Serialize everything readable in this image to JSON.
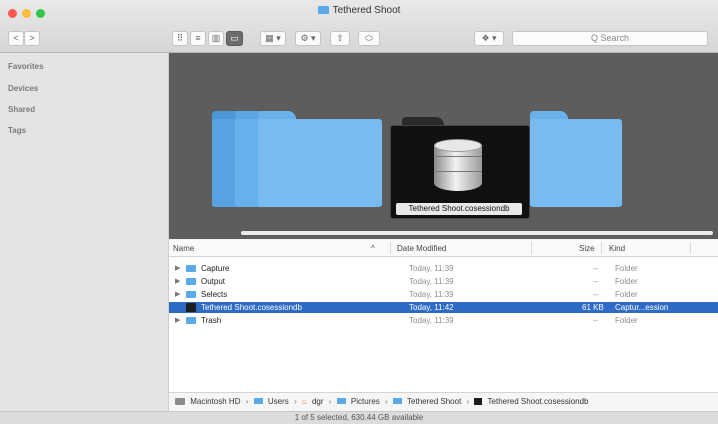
{
  "window": {
    "title": "Tethered Shoot"
  },
  "colors": {
    "close": "#fc5753",
    "minimize": "#fdbc40",
    "zoom": "#33c748",
    "folder": "#5aa9e8",
    "selection": "#2e6bc6"
  },
  "toolbar": {
    "back_glyph": "<",
    "forward_glyph": ">",
    "view_icon_glyph": "⠿",
    "view_list_glyph": "≡",
    "view_columns_glyph": "▥",
    "view_gallery_glyph": "▭",
    "group_glyph": "▦ ▾",
    "action_glyph": "⚙ ▾",
    "share_glyph": "⇧",
    "tag_glyph": "⬭",
    "dropbox_glyph": "❖ ▾",
    "search_placeholder": "Q Search"
  },
  "sidebar": {
    "sections": [
      "Favorites",
      "Devices",
      "Shared",
      "Tags"
    ]
  },
  "gallery": {
    "selected_label": "Tethered Shoot.cosessiondb"
  },
  "list": {
    "columns": {
      "name": "Name",
      "sort_indicator": "^",
      "date": "Date Modified",
      "size": "Size",
      "kind": "Kind"
    },
    "rows": [
      {
        "name": "Capture",
        "date": "Today, 11:39",
        "size": "--",
        "kind": "Folder",
        "disclosure": "▶",
        "selected": false
      },
      {
        "name": "Output",
        "date": "Today, 11:39",
        "size": "--",
        "kind": "Folder",
        "disclosure": "▶",
        "selected": false
      },
      {
        "name": "Selects",
        "date": "Today, 11:39",
        "size": "--",
        "kind": "Folder",
        "disclosure": "▶",
        "selected": false
      },
      {
        "name": "Tethered Shoot.cosessiondb",
        "date": "Today, 11:42",
        "size": "61 KB",
        "kind": "Captur...ession",
        "disclosure": "",
        "selected": true
      },
      {
        "name": "Trash",
        "date": "Today, 11:39",
        "size": "--",
        "kind": "Folder",
        "disclosure": "▶",
        "selected": false
      }
    ]
  },
  "path": {
    "items": [
      "Macintosh HD",
      "Users",
      "dgr",
      "Pictures",
      "Tethered Shoot",
      "Tethered Shoot.cosessiondb"
    ],
    "separator": "›"
  },
  "status": {
    "text": "1 of 5 selected, 630.44 GB available"
  }
}
